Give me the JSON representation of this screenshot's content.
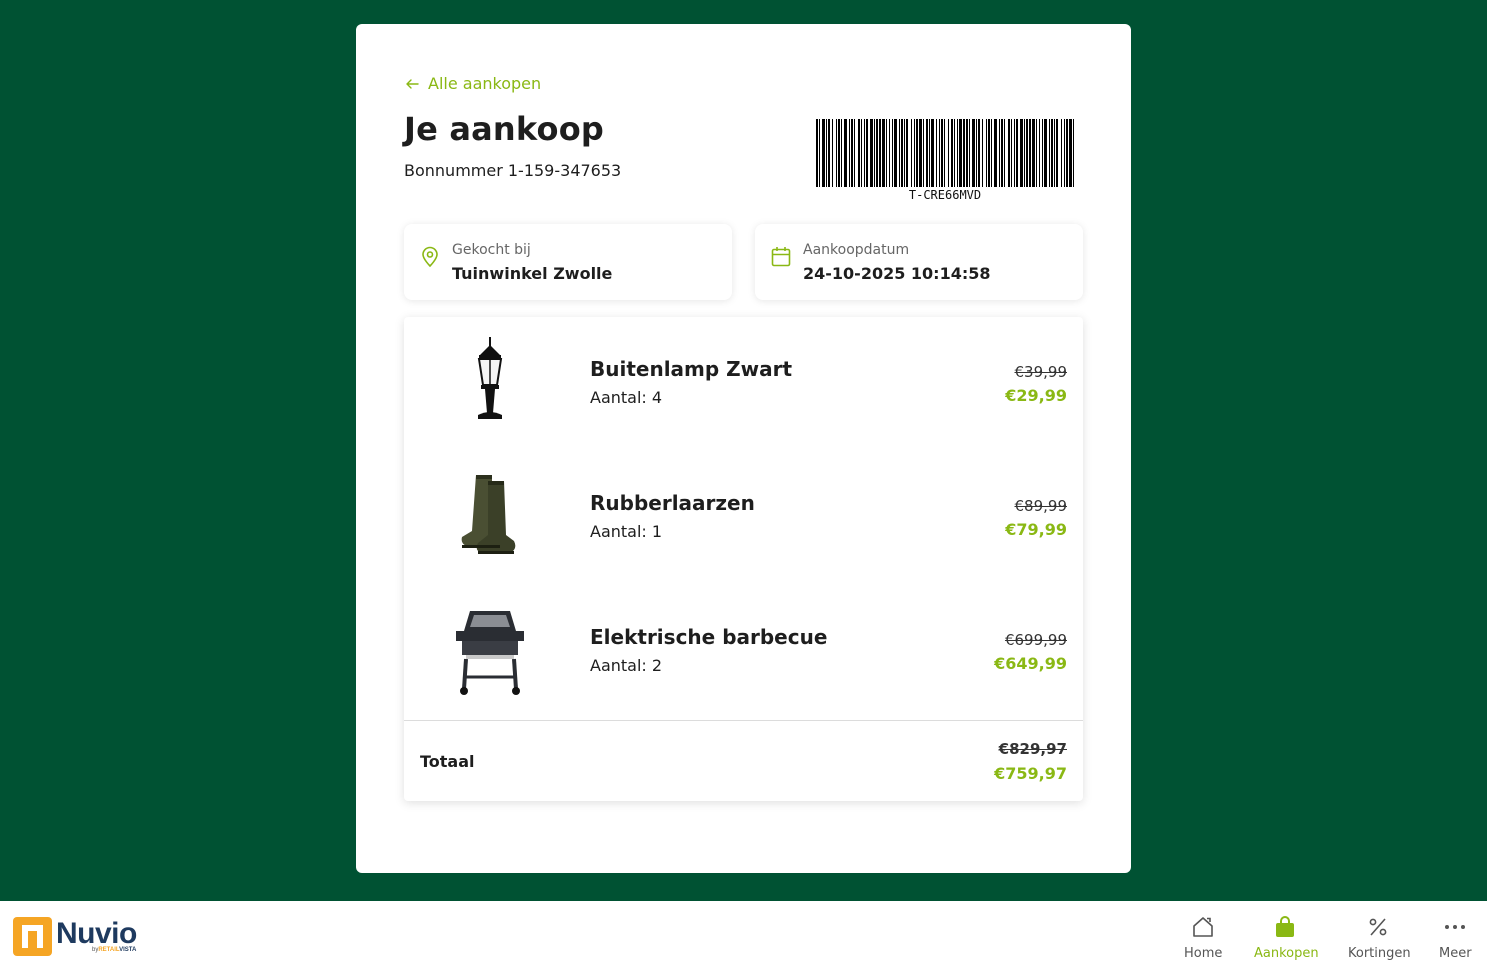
{
  "page": {
    "back_link": "Alle aankopen",
    "title": "Je aankoop",
    "receipt_number": "Bonnummer 1-159-347653",
    "barcode_text": "T-CRE66MVD"
  },
  "info": {
    "store_label": "Gekocht bij",
    "store_value": "Tuinwinkel Zwolle",
    "date_label": "Aankoopdatum",
    "date_value": "24-10-2025 10:14:58"
  },
  "items": [
    {
      "name": "Buitenlamp Zwart",
      "quantity": "Aantal: 4",
      "old_price": "€39,99",
      "new_price": "€29,99"
    },
    {
      "name": "Rubberlaarzen",
      "quantity": "Aantal: 1",
      "old_price": "€89,99",
      "new_price": "€79,99"
    },
    {
      "name": "Elektrische barbecue",
      "quantity": "Aantal: 2",
      "old_price": "€699,99",
      "new_price": "€649,99"
    }
  ],
  "total": {
    "label": "Totaal",
    "old_price": "€829,97",
    "new_price": "€759,97"
  },
  "brand": {
    "name": "Nuvio",
    "sub_prefix": "by",
    "sub_brand": "RETAIL",
    "sub_suffix": "VISTA"
  },
  "nav": [
    {
      "label": "Home",
      "icon": "home-icon",
      "active": false
    },
    {
      "label": "Aankopen",
      "icon": "shopping-bag-icon",
      "active": true
    },
    {
      "label": "Kortingen",
      "icon": "percent-icon",
      "active": false
    },
    {
      "label": "Meer",
      "icon": "more-icon",
      "active": false
    }
  ],
  "colors": {
    "background": "#005233",
    "accent": "#8ab814",
    "brand_orange": "#f5a524",
    "brand_navy": "#1e3a5f"
  }
}
